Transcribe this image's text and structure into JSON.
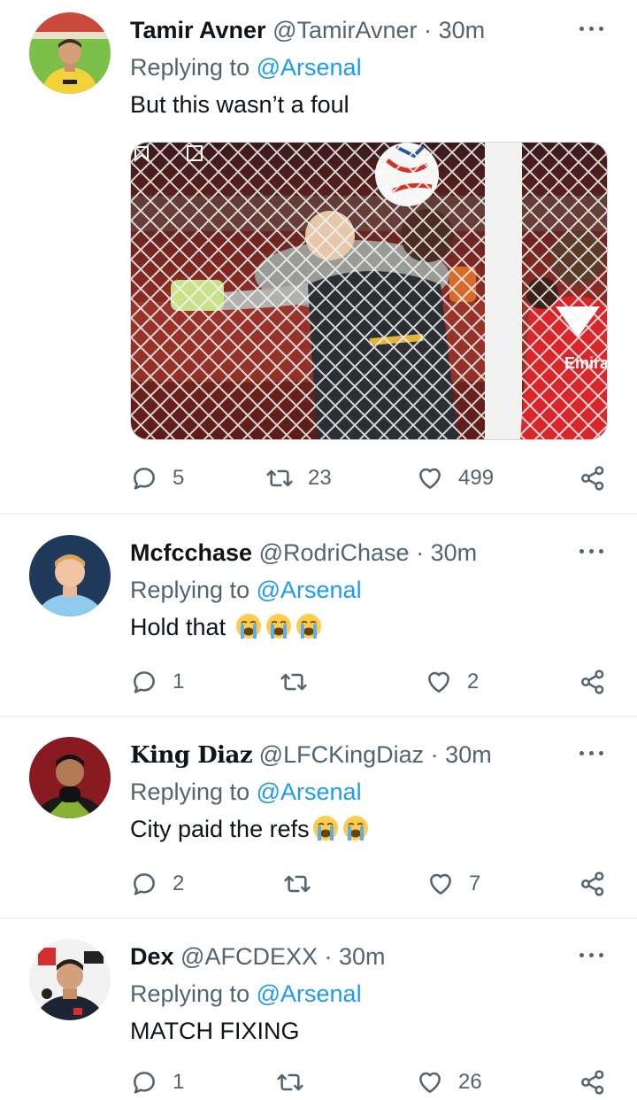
{
  "tweets": [
    {
      "name": "Tamir Avner",
      "handle": "@TamirAvner",
      "dot": "·",
      "time": "30m",
      "replying_prefix": "Replying to",
      "replying_to": "@Arsenal",
      "text": "But this wasn’t a foul",
      "replies": "5",
      "retweets": "23",
      "likes": "499",
      "has_media": true
    },
    {
      "name": "Mcfcchase",
      "handle": "@RodriChase",
      "dot": "·",
      "time": "30m",
      "replying_prefix": "Replying to",
      "replying_to": "@Arsenal",
      "text": "Hold that",
      "emoji_count": 3,
      "emoji_name": "loudly-crying-face",
      "replies": "1",
      "retweets": "",
      "likes": "2"
    },
    {
      "name": "King Diaz",
      "handle": "@LFCKingDiaz",
      "dot": "·",
      "time": "30m",
      "replying_prefix": "Replying to",
      "replying_to": "@Arsenal",
      "text": "City paid the refs",
      "emoji_count": 2,
      "emoji_name": "loudly-crying-face",
      "replies": "2",
      "retweets": "",
      "likes": "7"
    },
    {
      "name": "Dex",
      "handle": "@AFCDEXX",
      "dot": "·",
      "time": "30m",
      "replying_prefix": "Replying to",
      "replying_to": "@Arsenal",
      "text": "MATCH FIXING",
      "replies": "1",
      "retweets": "",
      "likes": "26"
    }
  ],
  "icons": {
    "reply": "reply-icon",
    "retweet": "retweet-icon",
    "like": "heart-icon",
    "share": "share-icon",
    "more": "more-dots-icon"
  },
  "colors": {
    "link": "#1d9bf0",
    "secondary_text": "#536471",
    "primary_text": "#0f1419",
    "divider": "#eff3f4"
  }
}
